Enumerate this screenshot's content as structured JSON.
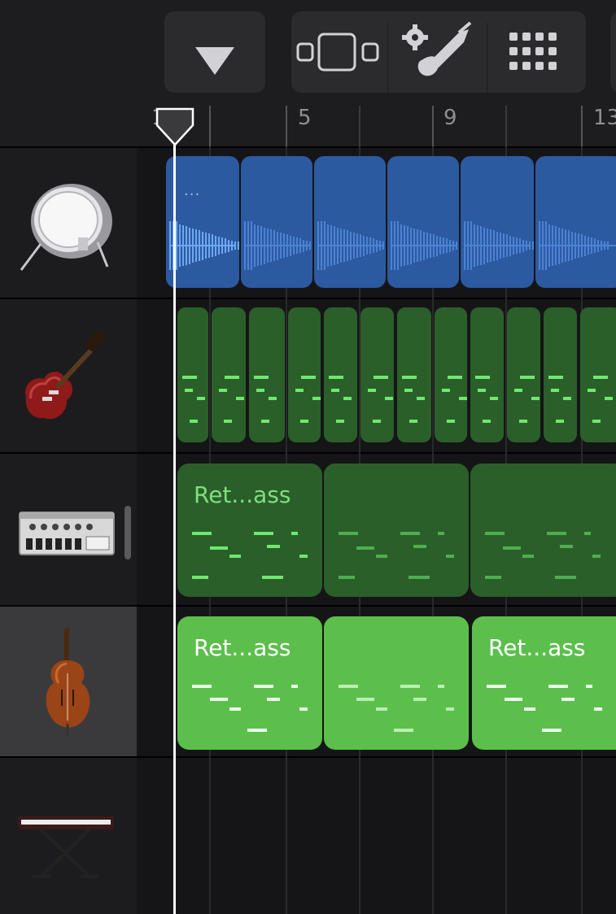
{
  "toolbar": {
    "left_button": {
      "icon": "triangle-down-icon"
    },
    "view_group": {
      "items": [
        {
          "icon": "tracks-view-icon"
        },
        {
          "icon": "instrument-settings-icon"
        },
        {
          "icon": "grid-apps-icon"
        }
      ]
    }
  },
  "ruler": {
    "labels": [
      "1",
      "5",
      "9",
      "13"
    ]
  },
  "tracks": [
    {
      "instrument": "drum-kit",
      "icon": "bass-drum-icon",
      "color": "#2c5aa0",
      "selected": false
    },
    {
      "instrument": "electric-guitar",
      "icon": "electric-guitar-icon",
      "color": "#2a5f2a",
      "selected": false
    },
    {
      "instrument": "bass-synth",
      "icon": "synth-module-icon",
      "color": "#2a5f2a",
      "selected": false
    },
    {
      "instrument": "upright-bass",
      "icon": "double-bass-icon",
      "color": "#5cbf4c",
      "selected": true
    },
    {
      "instrument": "keyboard",
      "icon": "keyboard-stand-icon",
      "color": "#1c1c1e",
      "selected": false
    }
  ],
  "regions": {
    "drums": {
      "label": "...",
      "count": 6
    },
    "guitar": {
      "count": 12
    },
    "synth": {
      "labels": [
        "Ret...ass",
        "",
        ""
      ]
    },
    "bass": {
      "labels": [
        "Ret...ass",
        "",
        "Ret...ass"
      ]
    }
  },
  "colors": {
    "drum_region": "#2c5aa0",
    "drum_wave": "#4c82d4",
    "drum_wave_active": "#6ea8f2",
    "guitar_region": "#2a5f2a",
    "midi_note_dark": "#6fe86f",
    "bass_region": "#5cbf4c",
    "bass_note": "#e8ffe8",
    "playhead": "#ffffff"
  }
}
